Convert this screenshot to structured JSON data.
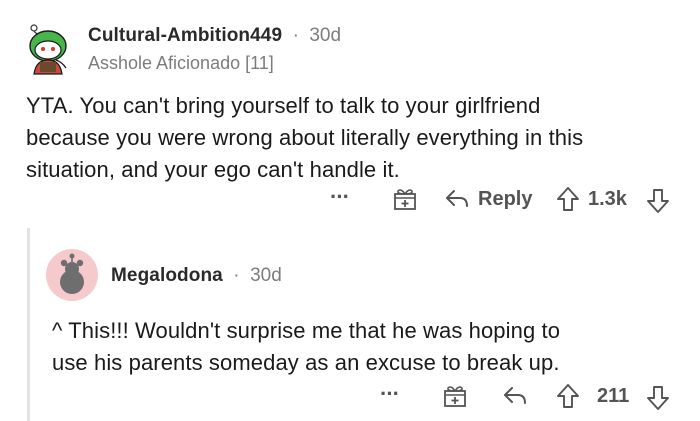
{
  "comment": {
    "username": "Cultural-Ambition449",
    "separator": "·",
    "time": "30d",
    "flair": "Asshole Aficionado [11]",
    "body_lines": [
      "YTA.  You can't bring yourself to talk to your girlfriend",
      "because you were wrong about literally everything in this",
      "situation, and your ego can't handle it."
    ],
    "actions": {
      "more": "···",
      "reply_label": "Reply",
      "score": "1.3k"
    }
  },
  "reply": {
    "username": "Megalodona",
    "separator": "·",
    "time": "30d",
    "body_lines": [
      "^ This!!! Wouldn't surprise me that he was hoping to",
      "use his parents someday as an excuse to break up."
    ],
    "actions": {
      "more": "···",
      "score": "211"
    }
  },
  "colors": {
    "reply_avatar_bg": "#f6c9cc",
    "avatar1_green": "#46b54a",
    "meta_gray": "#7c7c7c",
    "thread_line": "#e3e3e3"
  }
}
